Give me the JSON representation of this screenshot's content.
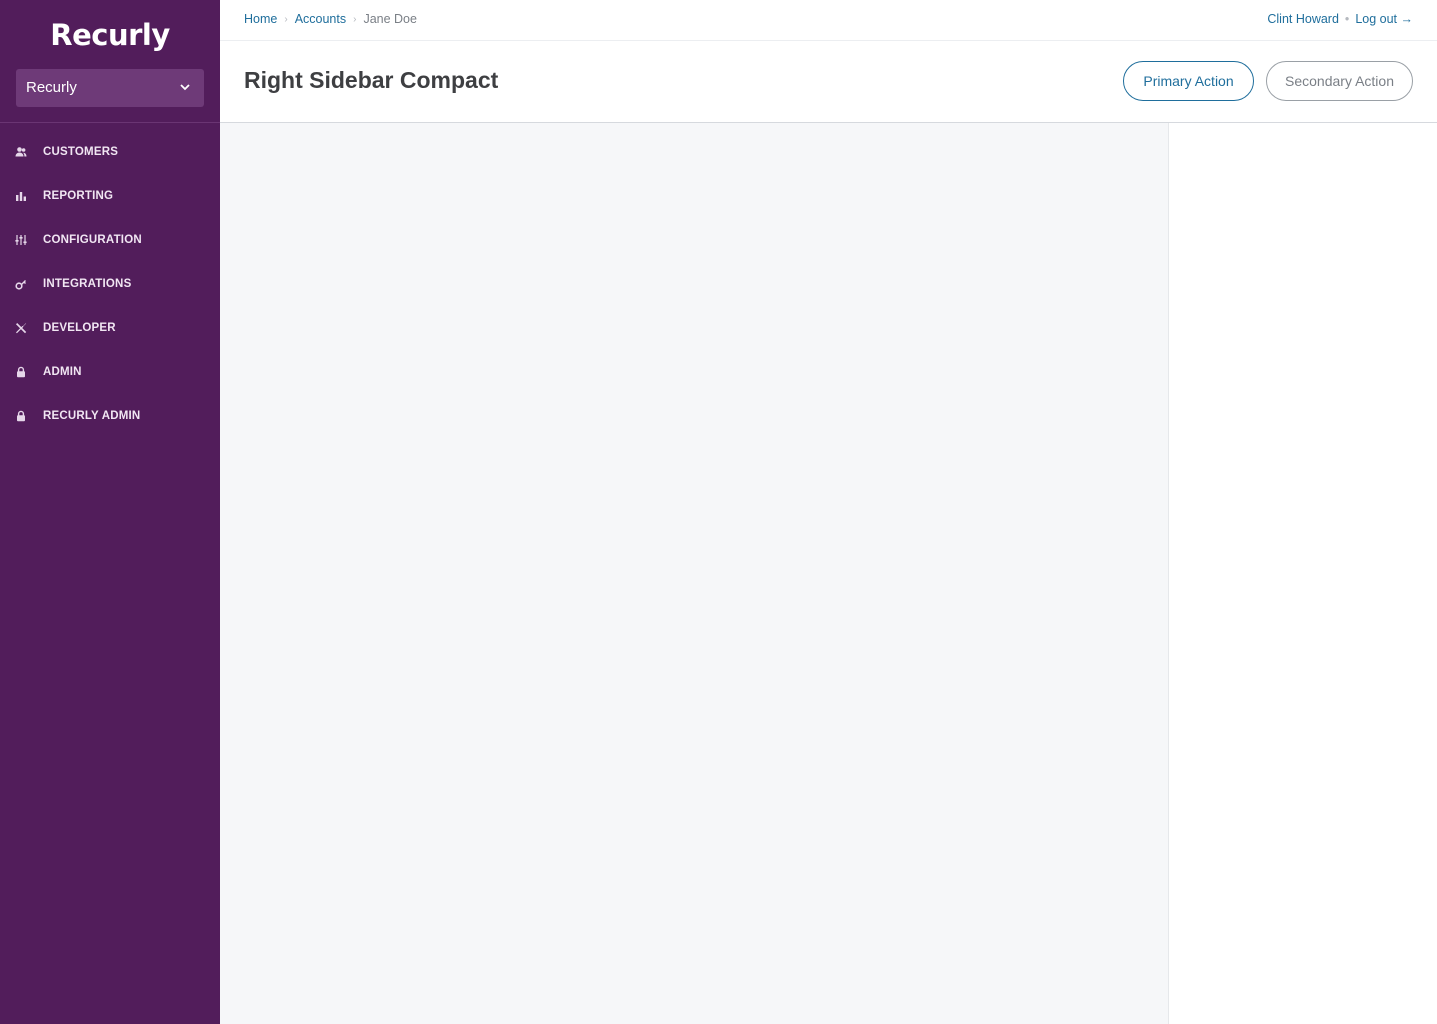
{
  "brand": {
    "logo_text": "Recurly"
  },
  "site_selector": {
    "selected": "Recurly",
    "icon": "chevron-down-icon"
  },
  "nav": {
    "items": [
      {
        "label": "CUSTOMERS",
        "icon": "customers-icon"
      },
      {
        "label": "REPORTING",
        "icon": "bar-chart-icon"
      },
      {
        "label": "CONFIGURATION",
        "icon": "sliders-icon"
      },
      {
        "label": "INTEGRATIONS",
        "icon": "key-icon"
      },
      {
        "label": "DEVELOPER",
        "icon": "tools-icon"
      },
      {
        "label": "ADMIN",
        "icon": "lock-icon"
      },
      {
        "label": "RECURLY ADMIN",
        "icon": "lock-icon"
      }
    ]
  },
  "breadcrumb": {
    "items": [
      "Home",
      "Accounts"
    ],
    "current": "Jane Doe"
  },
  "user": {
    "name": "Clint Howard",
    "logout": "Log out →"
  },
  "page": {
    "title": "Right Sidebar Compact",
    "primary_action": "Primary Action",
    "secondary_action": "Secondary Action"
  },
  "colors": {
    "sidebar_bg": "#521d5b",
    "link": "#1f6e9c",
    "content_bg": "#f6f7f9"
  }
}
